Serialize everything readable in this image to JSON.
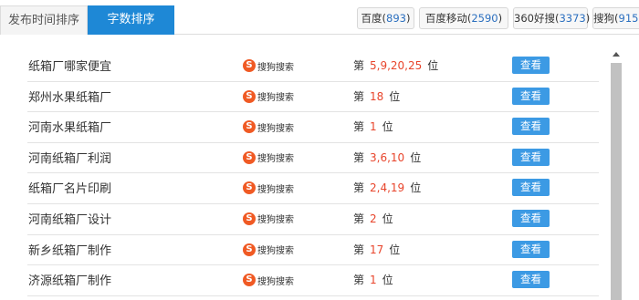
{
  "sort_tabs": {
    "time": "发布时间排序",
    "count": "字数排序"
  },
  "engine_tabs": [
    {
      "name": "百度",
      "count": "893"
    },
    {
      "name": "百度移动",
      "count": "2590"
    },
    {
      "name": "360好搜",
      "count": "3373"
    },
    {
      "name": "搜狗",
      "count": "915"
    }
  ],
  "rank_prefix": "第",
  "rank_suffix": "位",
  "view_label": "查看",
  "engine_label": "搜狗搜索",
  "rows": [
    {
      "keyword": "纸箱厂哪家便宜",
      "rank": "5,9,20,25"
    },
    {
      "keyword": "郑州水果纸箱厂",
      "rank": "18"
    },
    {
      "keyword": "河南水果纸箱厂",
      "rank": "1"
    },
    {
      "keyword": "河南纸箱厂利润",
      "rank": "3,6,10"
    },
    {
      "keyword": "纸箱厂名片印刷",
      "rank": "2,4,19"
    },
    {
      "keyword": "河南纸箱厂设计",
      "rank": "2"
    },
    {
      "keyword": "新乡纸箱厂制作",
      "rank": "17"
    },
    {
      "keyword": "济源纸箱厂制作",
      "rank": "1"
    }
  ],
  "colors": {
    "active_tab": "#1e88d6",
    "rank_value": "#e8452c",
    "view_button": "#3c9ae4",
    "sogou_logo": "#f05a24",
    "engine_count": "#2b6fbf"
  }
}
